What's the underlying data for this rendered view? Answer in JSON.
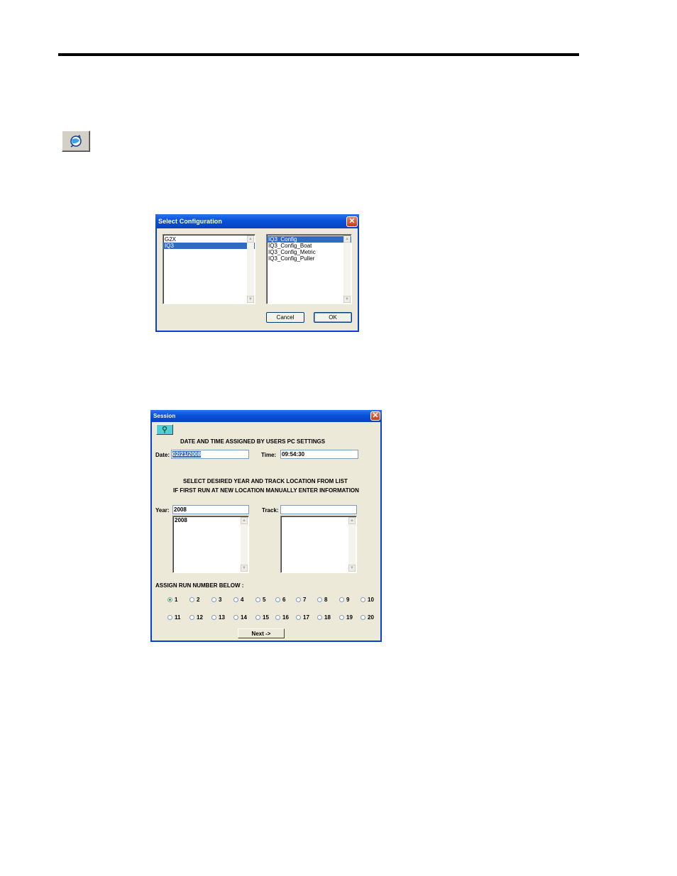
{
  "config_dialog": {
    "title": "Select Configuration",
    "close_label": "✕",
    "left_list": [
      "G2X",
      "IQ3"
    ],
    "left_selected_index": 1,
    "right_list": [
      "IQ3_Config",
      "IQ3_Config_Boat",
      "IQ3_Config_Metric",
      "IQ3_Config_Puller"
    ],
    "right_selected_index": 0,
    "cancel_label": "Cancel",
    "ok_label": "OK"
  },
  "session_dialog": {
    "title": "Session",
    "close_label": "✕",
    "date_time_heading": "DATE AND TIME  ASSIGNED BY USERS PC SETTINGS",
    "date_label": "Date:",
    "date_value": "02/21/2008",
    "time_label": "Time:",
    "time_value": "09:54:30",
    "instruction_line1": "SELECT DESIRED YEAR AND TRACK LOCATION FROM LIST",
    "instruction_line2": "IF FIRST RUN AT NEW LOCATION MANUALLY ENTER INFORMATION",
    "year_label": "Year:",
    "year_value": "2008",
    "year_list": [
      "2008"
    ],
    "track_label": "Track:",
    "track_value": "",
    "track_list": [],
    "run_heading": "ASSIGN RUN NUMBER BELOW :",
    "runs": [
      "1",
      "2",
      "3",
      "4",
      "5",
      "6",
      "7",
      "8",
      "9",
      "10",
      "11",
      "12",
      "13",
      "14",
      "15",
      "16",
      "17",
      "18",
      "19",
      "20"
    ],
    "selected_run": "1",
    "next_label": "Next ->"
  },
  "icons": {
    "toolbar_button": "configuration-globe-icon",
    "help_button": "help-key-icon",
    "scroll_up": "scroll-up-arrow-icon",
    "scroll_down": "scroll-down-arrow-icon"
  },
  "colors": {
    "titlebar": "#0a52d8",
    "selection": "#316ac5",
    "dialog_face": "#ece9d8",
    "close_button": "#c73d18",
    "help_button": "#4fd0d8"
  }
}
